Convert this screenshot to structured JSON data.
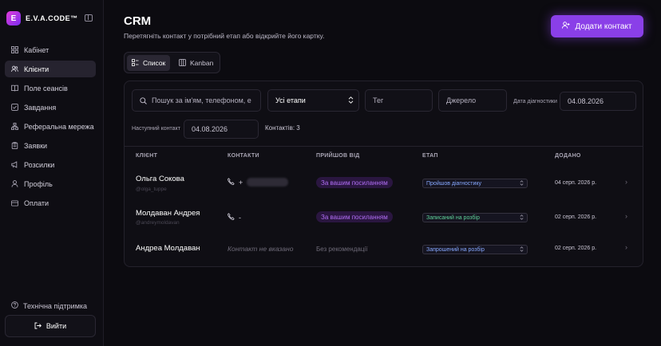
{
  "brand": {
    "logo_letter": "E",
    "name": "E.V.A.CODE™"
  },
  "sidebar": {
    "items": [
      {
        "label": "Кабінет",
        "icon": "dashboard-icon",
        "active": false
      },
      {
        "label": "Клієнти",
        "icon": "users-icon",
        "active": true
      },
      {
        "label": "Поле сеансів",
        "icon": "book-icon",
        "active": false
      },
      {
        "label": "Завдання",
        "icon": "check-icon",
        "active": false
      },
      {
        "label": "Реферальна мережа",
        "icon": "network-icon",
        "active": false
      },
      {
        "label": "Заявки",
        "icon": "clipboard-icon",
        "active": false
      },
      {
        "label": "Розсилки",
        "icon": "megaphone-icon",
        "active": false
      },
      {
        "label": "Профіль",
        "icon": "user-icon",
        "active": false
      },
      {
        "label": "Оплати",
        "icon": "card-icon",
        "active": false
      }
    ],
    "support": "Технічна підтримка",
    "logout": "Вийти"
  },
  "header": {
    "title": "CRM",
    "subtitle": "Перетягніть контакт у потрібний етап або відкрийте його картку.",
    "add_button": "Додати контакт"
  },
  "views": {
    "list": "Список",
    "kanban": "Kanban"
  },
  "filters": {
    "search_placeholder": "Пошук за ім'ям, телефоном, е",
    "stage_select": "Усі етапи",
    "tag_placeholder": "Тег",
    "source_placeholder": "Джерело",
    "diag_date_label": "Дата діагностики",
    "diag_date_value": "04.08.2026",
    "next_contact_label": "Наступний контакт",
    "next_contact_value": "04.08.2026",
    "contacts_count": "Контактів: 3"
  },
  "table": {
    "headers": {
      "client": "КЛІЄНТ",
      "contacts": "КОНТАКТИ",
      "source": "ПРИЙШОВ ВІД",
      "stage": "ЕТАП",
      "added": "ДОДАНО"
    },
    "rows": [
      {
        "name": "Ольга Сокова",
        "sub": "@olga_tuppe",
        "contact": "+",
        "contact_blurred": true,
        "source": "За вашим посиланням",
        "source_badge": true,
        "stage": "Пройшов діагностику",
        "stage_color": "#86a8ff",
        "added": "04 серп. 2026 р."
      },
      {
        "name": "Молдаван Андрея",
        "sub": "@andreymoldavan",
        "contact": "-",
        "contact_blurred": false,
        "source": "За вашим посиланням",
        "source_badge": true,
        "stage": "Записаний на розбір",
        "stage_color": "#5fd39a",
        "added": "02 серп. 2026 р."
      },
      {
        "name": "Андреа Молдаван",
        "sub": "",
        "contact": "Контакт не вказано",
        "contact_blurred": false,
        "source": "Без рекомендації",
        "source_badge": false,
        "stage": "Запрошений на розбір",
        "stage_color": "#86a8ff",
        "added": "02 серп. 2026 р."
      }
    ]
  },
  "colors": {
    "accent": "#8a3fe8",
    "badge_bg": "#2a1640",
    "badge_text": "#b16ef5"
  }
}
